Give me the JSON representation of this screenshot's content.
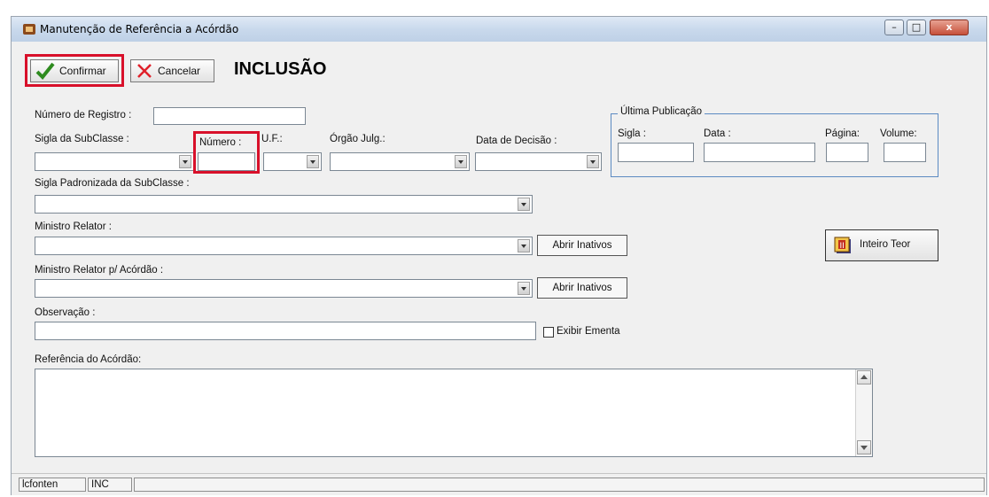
{
  "window": {
    "title": "Manutenção de Referência a Acórdão",
    "controls": {
      "minimize": "–",
      "maximize": "□",
      "close": "x"
    }
  },
  "toolbar": {
    "confirm_label": "Confirmar",
    "cancel_label": "Cancelar",
    "mode_heading": "INCLUSÃO"
  },
  "form": {
    "numero_registro_label": "Número de Registro :",
    "sigla_subclasse_label": "Sigla da SubClasse :",
    "numero_label": "Número :",
    "uf_label": "U.F.:",
    "orgao_julg_label": "Órgão Julg.:",
    "data_decisao_label": "Data de Decisão :",
    "sigla_padronizada_label": "Sigla Padronizada da SubClasse :",
    "ministro_relator_label": "Ministro Relator :",
    "ministro_relator_acordao_label": "Ministro Relator p/ Acórdão :",
    "observacao_label": "Observação :",
    "exibir_ementa_label": "Exibir Ementa",
    "referencia_label": "Referência do Acórdão:",
    "abrir_inativos_1": "Abrir Inativos",
    "abrir_inativos_2": "Abrir Inativos",
    "inteiro_teor_label": "Inteiro Teor"
  },
  "ultima_publicacao": {
    "legend": "Última Publicação",
    "sigla_label": "Sigla :",
    "data_label": "Data :",
    "pagina_label": "Página:",
    "volume_label": "Volume:"
  },
  "statusbar": {
    "cell1": "lcfonten",
    "cell2": "INC",
    "cell3": ""
  },
  "colors": {
    "highlight_border": "#d8102a",
    "groupbox_border": "#5b8ac2",
    "window_bg": "#f0f0f0"
  },
  "icons": {
    "confirm": "checkmark-icon",
    "cancel": "red-x-icon",
    "inteiro_teor": "document-icon",
    "app": "app-icon"
  }
}
